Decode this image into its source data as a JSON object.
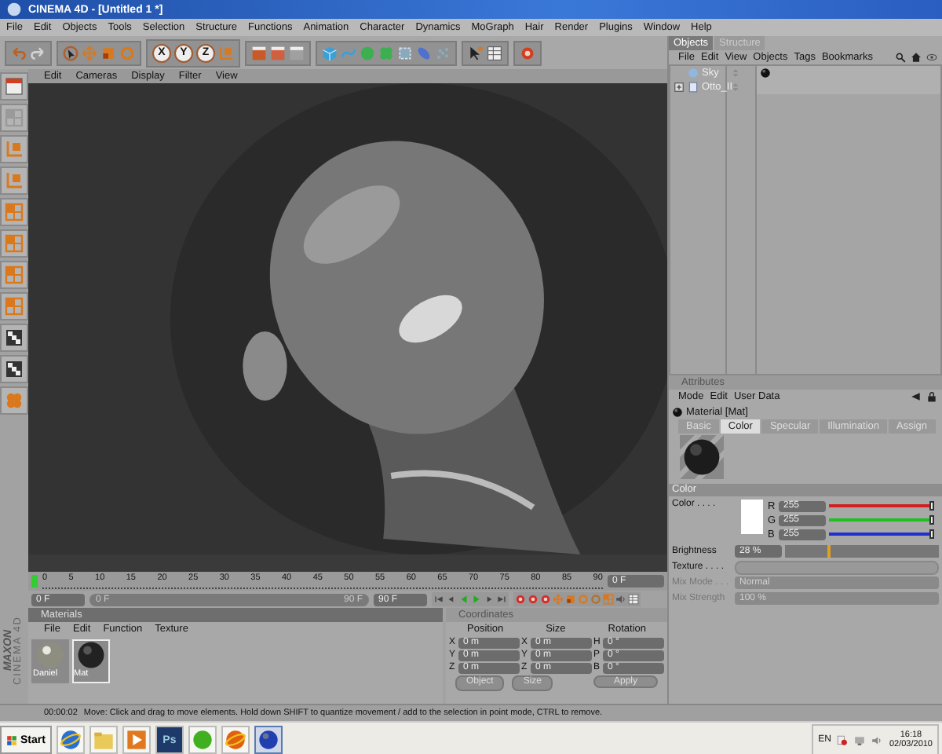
{
  "window": {
    "title": "CINEMA 4D - [Untitled 1 *]"
  },
  "menu": [
    "File",
    "Edit",
    "Objects",
    "Tools",
    "Selection",
    "Structure",
    "Functions",
    "Animation",
    "Character",
    "Dynamics",
    "MoGraph",
    "Hair",
    "Render",
    "Plugins",
    "Window",
    "Help"
  ],
  "toolbar": {
    "axis_buttons": [
      "X",
      "Y",
      "Z"
    ]
  },
  "viewport": {
    "menu": [
      "Edit",
      "Cameras",
      "Display",
      "Filter",
      "View"
    ],
    "kind": "picture"
  },
  "objects_panel": {
    "tabs": [
      {
        "label": "Objects",
        "selected": true
      },
      {
        "label": "Structure",
        "selected": false
      }
    ],
    "menu": [
      "File",
      "Edit",
      "View",
      "Objects",
      "Tags",
      "Bookmarks"
    ],
    "tree": [
      {
        "name": "Sky",
        "has_children": false,
        "material_tag": true
      },
      {
        "name": "Otto_II",
        "has_children": true,
        "material_tag": false
      }
    ]
  },
  "attributes": {
    "title": "Attributes",
    "menu": [
      "Mode",
      "Edit",
      "User Data"
    ],
    "material": "Material [Mat]",
    "tabs": [
      {
        "label": "Basic",
        "selected": false
      },
      {
        "label": "Color",
        "selected": true
      },
      {
        "label": "Specular",
        "selected": false
      },
      {
        "label": "Illumination",
        "selected": false
      },
      {
        "label": "Assign",
        "selected": false
      }
    ],
    "section": "Color",
    "color": {
      "label": "Color . . . .",
      "channels": [
        {
          "name": "R",
          "value": "255",
          "level": 1,
          "color": "#d02020"
        },
        {
          "name": "G",
          "value": "255",
          "level": 1,
          "color": "#20c020"
        },
        {
          "name": "B",
          "value": "255",
          "level": 1,
          "color": "#2030d0"
        }
      ]
    },
    "brightness": {
      "label": "Brightness",
      "value": "28 %",
      "level": 0.28
    },
    "texture": {
      "label": "Texture . . . ."
    },
    "mix_mode": {
      "label": "Mix Mode . . .",
      "value": "Normal",
      "disabled": true
    },
    "mix_strength": {
      "label": "Mix Strength",
      "value": "100 %",
      "disabled": true
    }
  },
  "timeline": {
    "ticks": [
      "0",
      "5",
      "10",
      "15",
      "20",
      "25",
      "30",
      "35",
      "40",
      "45",
      "50",
      "55",
      "60",
      "65",
      "70",
      "75",
      "80",
      "85",
      "90"
    ],
    "current": "0 F",
    "start": "0 F",
    "range_start": "0 F",
    "range_end": "90 F",
    "end": "90 F"
  },
  "materials": {
    "title": "Materials",
    "menu": [
      "File",
      "Edit",
      "Function",
      "Texture"
    ],
    "items": [
      {
        "name": "Daniel",
        "selected": false
      },
      {
        "name": "Mat",
        "selected": true
      }
    ]
  },
  "coordinates": {
    "title": "Coordinates",
    "headers": [
      "Position",
      "Size",
      "Rotation"
    ],
    "rows": [
      [
        {
          "axis": "X",
          "value": "0 m"
        },
        {
          "axis": "X",
          "value": "0 m"
        },
        {
          "axis": "H",
          "value": "0 °"
        }
      ],
      [
        {
          "axis": "Y",
          "value": "0 m"
        },
        {
          "axis": "Y",
          "value": "0 m"
        },
        {
          "axis": "P",
          "value": "0 °"
        }
      ],
      [
        {
          "axis": "Z",
          "value": "0 m"
        },
        {
          "axis": "Z",
          "value": "0 m"
        },
        {
          "axis": "B",
          "value": "0 °"
        }
      ]
    ],
    "dropdowns": [
      "Object",
      "Size"
    ],
    "button": "Apply"
  },
  "logo": {
    "brand": "MAXON",
    "product": "CINEMA 4D"
  },
  "status_bar": {
    "time": "00:00:02",
    "message": "Move: Click and drag to move elements. Hold down SHIFT to quantize movement / add to the selection in point mode, CTRL to remove."
  },
  "taskbar": {
    "start": "Start",
    "apps": [
      {
        "selected": false
      },
      {
        "selected": false
      },
      {
        "selected": false
      },
      {
        "label": "Ps",
        "selected": false
      },
      {
        "selected": false
      },
      {
        "selected": false
      },
      {
        "selected": true
      }
    ],
    "language": "EN",
    "time": "16:18",
    "date": "02/03/2010"
  }
}
